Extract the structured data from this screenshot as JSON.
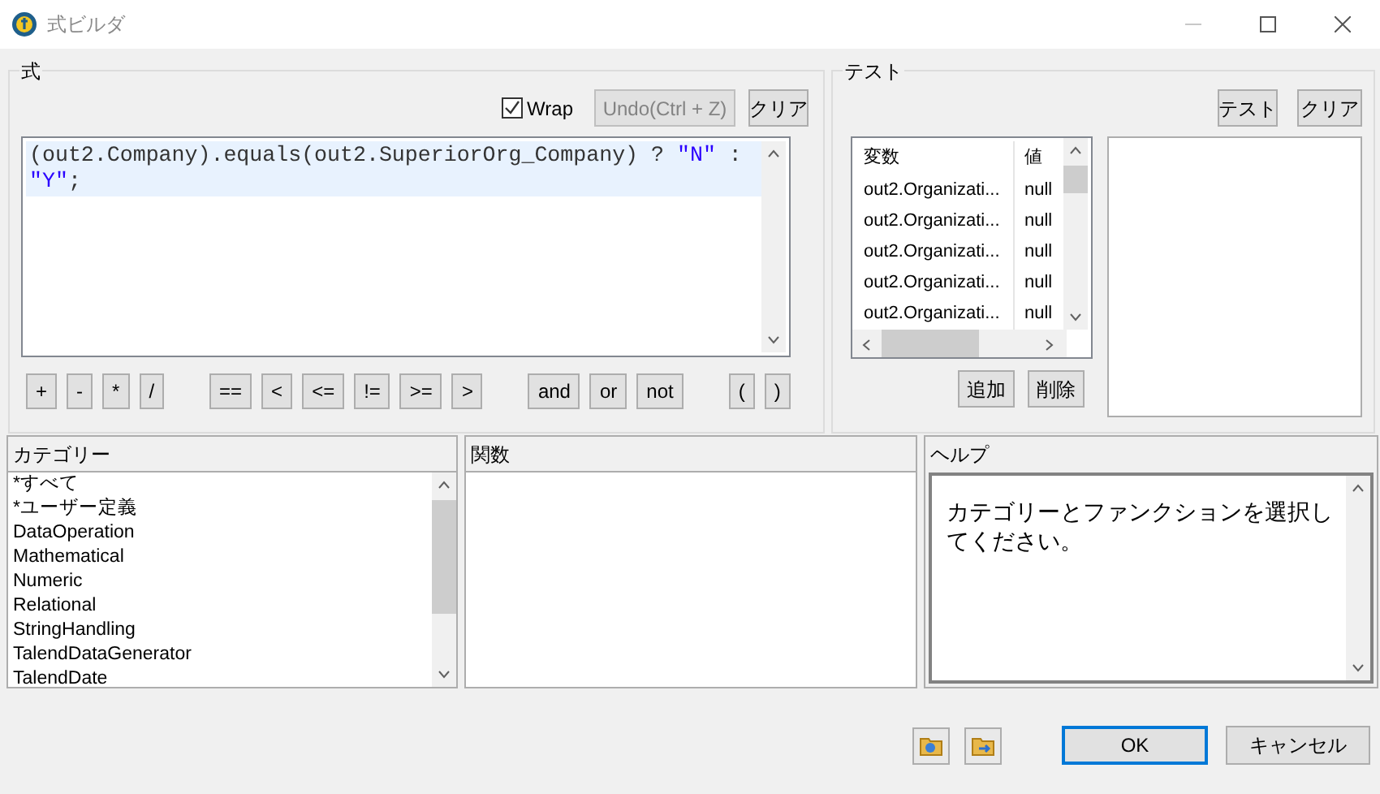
{
  "window": {
    "title": "式ビルダ"
  },
  "expression": {
    "title": "式",
    "wrap": {
      "label": "Wrap",
      "checked": true
    },
    "undo": {
      "label": "Undo(Ctrl + Z)",
      "disabled": true
    },
    "clear": "クリア",
    "code": [
      {
        "kind": "code",
        "text": "(out2.Company).equals(out2.SuperiorOrg_Company) ? "
      },
      {
        "kind": "string",
        "text": "\"N\""
      },
      {
        "kind": "code",
        "text": " : "
      },
      {
        "kind": "string",
        "text": "\"Y\""
      },
      {
        "kind": "code",
        "text": ";"
      }
    ],
    "operators": [
      [
        "+",
        "-",
        "*",
        "/"
      ],
      [
        "==",
        "<",
        "<=",
        "!=",
        ">=",
        ">"
      ],
      [
        "and",
        "or",
        "not"
      ],
      [
        "(",
        ")"
      ]
    ]
  },
  "test": {
    "title": "テスト",
    "test_button": "テスト",
    "clear": "クリア",
    "columns": [
      "変数",
      "値"
    ],
    "rows": [
      [
        "out2.Organizati...",
        "null"
      ],
      [
        "out2.Organizati...",
        "null"
      ],
      [
        "out2.Organizati...",
        "null"
      ],
      [
        "out2.Organizati...",
        "null"
      ],
      [
        "out2.Organizati...",
        "null"
      ]
    ],
    "add": "追加",
    "delete": "削除"
  },
  "categories": {
    "title": "カテゴリー",
    "items": [
      "*すべて",
      "*ユーザー定義",
      "DataOperation",
      "Mathematical",
      "Numeric",
      "Relational",
      "StringHandling",
      "TalendDataGenerator",
      "TalendDate"
    ]
  },
  "functions": {
    "title": "関数"
  },
  "help": {
    "title": "ヘルプ",
    "text": "カテゴリーとファンクションを選択してください。"
  },
  "buttons": {
    "ok": "OK",
    "cancel": "キャンセル"
  }
}
